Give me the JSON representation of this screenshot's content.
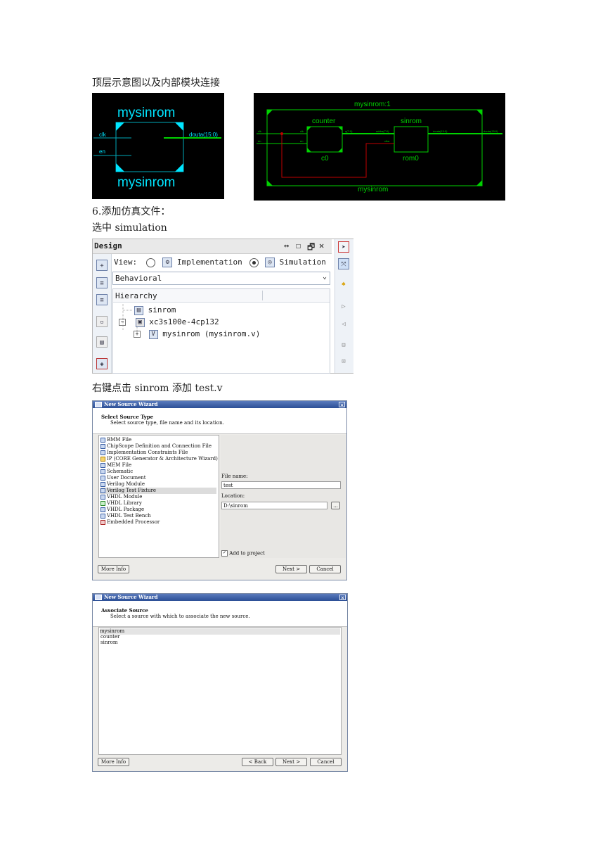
{
  "paragraphs": {
    "p1": "顶层示意图以及内部模块连接",
    "p2": "6.添加仿真文件：",
    "p3": "选中 simulation",
    "p4": "右键点击 sinrom 添加 test.v"
  },
  "schematic_top": {
    "name_top": "mysinrom",
    "name_bottom": "mysinrom",
    "port_clk": "clk",
    "port_en": "en",
    "port_douta": "douta(15:0)"
  },
  "schematic_internal": {
    "title": "mysinrom:1",
    "counter_label": "counter",
    "counter_inst": "c0",
    "sinrom_label": "sinrom",
    "sinrom_inst": "rom0",
    "bottom_label": "mysinrom",
    "pin_clk": "clk",
    "pin_en": "en",
    "pin_clk_in": "clk",
    "pin_en_in": "en",
    "pin_q": "q(7:0)",
    "pin_addra": "addra(7:0)",
    "pin_clka": "clka",
    "pin_douta_inner": "douta(15:0)",
    "pin_douta_out": "douta(15:0)"
  },
  "design_panel": {
    "title": "Design",
    "header_icons": [
      "↔",
      "☐",
      "🗗",
      "✕"
    ],
    "view_label": "View:",
    "opt_implementation": "Implementation",
    "opt_simulation": "Simulation",
    "selected_view": "Simulation",
    "dropdown_value": "Behavioral",
    "hierarchy_label": "Hierarchy",
    "tree": [
      {
        "label": "sinrom",
        "icon": "file-icon"
      },
      {
        "label": "xc3s100e-4cp132",
        "icon": "chip-icon"
      },
      {
        "label": "mysinrom (mysinrom.v)",
        "icon": "verilog-icon"
      }
    ]
  },
  "wizard1": {
    "title": "New Source Wizard",
    "heading": "Select Source Type",
    "subheading": "Select source type, file name and its location.",
    "source_types": [
      "BMM File",
      "ChipScope Definition and Connection File",
      "Implementation Constraints File",
      "IP (CORE Generator & Architecture Wizard)",
      "MEM File",
      "Schematic",
      "User Document",
      "Verilog Module",
      "Verilog Test Fixture",
      "VHDL Module",
      "VHDL Library",
      "VHDL Package",
      "VHDL Test Bench",
      "Embedded Processor"
    ],
    "selected_type": "Verilog Test Fixture",
    "file_name_label": "File name:",
    "file_name_value": "test",
    "location_label": "Location:",
    "location_value": "D:\\sinrom",
    "browse_label": "...",
    "add_to_project_label": "Add to project",
    "more_info": "More Info",
    "next": "Next >",
    "cancel": "Cancel"
  },
  "wizard2": {
    "title": "New Source Wizard",
    "heading": "Associate Source",
    "subheading": "Select a source with which to associate the new source.",
    "sources": [
      "mysinrom",
      "counter",
      "sinrom"
    ],
    "more_info": "More Info",
    "back": "< Back",
    "next": "Next >",
    "cancel": "Cancel"
  },
  "colors": {
    "schematic_bg": "#000000",
    "schematic_cyan": "#00e5ff",
    "schematic_green": "#00d200",
    "schematic_red": "#c00000"
  }
}
